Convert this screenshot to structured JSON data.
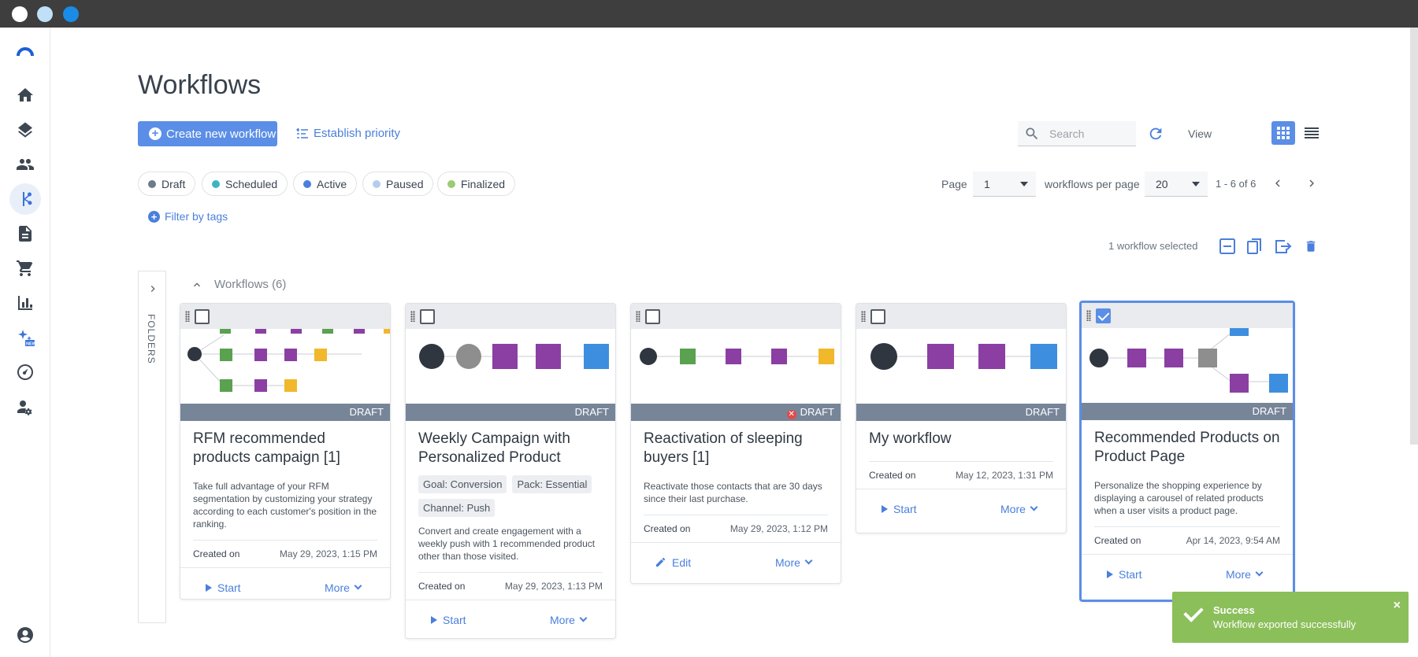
{
  "window": {
    "dot_colors": [
      "#ffffff",
      "#bfe0f7",
      "#1a8be6"
    ]
  },
  "page": {
    "title": "Workflows"
  },
  "toolbar": {
    "create_label": "Create new workflow",
    "priority_label": "Establish priority",
    "search_placeholder": "Search",
    "view_label": "View"
  },
  "status_filters": [
    {
      "label": "Draft",
      "color": "#6f7b8c"
    },
    {
      "label": "Scheduled",
      "color": "#3fb3c4"
    },
    {
      "label": "Active",
      "color": "#4a7fdc"
    },
    {
      "label": "Paused",
      "color": "#b3cdef"
    },
    {
      "label": "Finalized",
      "color": "#9ccb72"
    }
  ],
  "filter_tags_label": "Filter by tags",
  "pagination": {
    "page_label": "Page",
    "page_value": "1",
    "per_page_label": "workflows per page",
    "per_page_value": "20",
    "range": "1 - 6 of 6"
  },
  "selection": {
    "text": "1 workflow selected"
  },
  "folders_label": "FOLDERS",
  "group": {
    "title": "Workflows (6)"
  },
  "cards": [
    {
      "title": "RFM recommended products campaign [1]",
      "status": "DRAFT",
      "description": "Take full advantage of your RFM segmentation by customizing your strategy according to each customer's position in the ranking.",
      "tags": [],
      "created_label": "Created on",
      "created_value": "May 29, 2023, 1:15 PM",
      "primary_action": "Start",
      "more_label": "More",
      "selected": false
    },
    {
      "title": "Weekly Campaign with Personalized Product",
      "status": "DRAFT",
      "description": "Convert and create engagement with a weekly push with 1 recommended product other than those visited.",
      "tags": [
        "Goal: Conversion",
        "Pack: Essential",
        "Channel: Push"
      ],
      "created_label": "Created on",
      "created_value": "May 29, 2023, 1:13 PM",
      "primary_action": "Start",
      "more_label": "More",
      "selected": false
    },
    {
      "title": "Reactivation of sleeping buyers [1]",
      "status": "DRAFT",
      "description": "Reactivate those contacts that are 30 days since their last purchase.",
      "tags": [],
      "created_label": "Created on",
      "created_value": "May 29, 2023, 1:12 PM",
      "primary_action": "Edit",
      "more_label": "More",
      "selected": false
    },
    {
      "title": "My workflow",
      "status": "DRAFT",
      "description": "",
      "tags": [],
      "created_label": "Created on",
      "created_value": "May 12, 2023, 1:31 PM",
      "primary_action": "Start",
      "more_label": "More",
      "selected": false
    },
    {
      "title": "Recommended Products on Product Page",
      "status": "DRAFT",
      "description": "Personalize the shopping experience by displaying a carousel of related products when a user visits a product page.",
      "tags": [],
      "created_label": "Created on",
      "created_value": "Apr 14, 2023, 9:54 AM",
      "primary_action": "Start",
      "more_label": "More",
      "selected": true
    }
  ],
  "toast": {
    "title": "Success",
    "message": "Workflow exported successfully",
    "close": "×"
  },
  "colors": {
    "accent": "#5b8ee6",
    "draft": "#778599",
    "success": "#8bbf5a"
  }
}
